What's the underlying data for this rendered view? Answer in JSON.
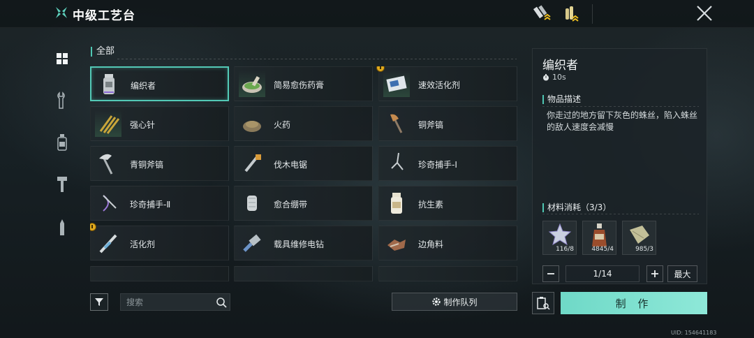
{
  "header": {
    "title": "中级工艺台",
    "icons": [
      "workbench-logo-icon",
      "tool-upgrade-icon",
      "ammo-upgrade-icon",
      "close-icon"
    ]
  },
  "sidenav": {
    "items": [
      {
        "icon": "grid-icon",
        "active": true
      },
      {
        "icon": "wrench-icon",
        "active": false
      },
      {
        "icon": "bottle-icon",
        "active": false
      },
      {
        "icon": "hammer-icon",
        "active": false
      },
      {
        "icon": "bullet-icon",
        "active": false
      }
    ]
  },
  "section": {
    "title": "全部"
  },
  "items": [
    {
      "label": "编织者",
      "icon": "weaver-jar-icon",
      "selected": true,
      "badge": false
    },
    {
      "label": "简易愈伤药膏",
      "icon": "mortar-ointment-icon",
      "selected": false,
      "badge": false
    },
    {
      "label": "速效活化剂",
      "icon": "activator-box-icon",
      "selected": false,
      "badge": true
    },
    {
      "label": "强心针",
      "icon": "syringes-icon",
      "selected": false,
      "badge": false
    },
    {
      "label": "火药",
      "icon": "gunpowder-icon",
      "selected": false,
      "badge": false
    },
    {
      "label": "铜斧镐",
      "icon": "copper-axe-icon",
      "selected": false,
      "badge": false
    },
    {
      "label": "青铜斧镐",
      "icon": "bronze-pickaxe-icon",
      "selected": false,
      "badge": false
    },
    {
      "label": "伐木电锯",
      "icon": "chainsaw-icon",
      "selected": false,
      "badge": false
    },
    {
      "label": "珍奇捕手-I",
      "icon": "grabber-icon",
      "selected": false,
      "badge": false
    },
    {
      "label": "珍奇捕手-Ⅱ",
      "icon": "grabber-bow-icon",
      "selected": false,
      "badge": false
    },
    {
      "label": "愈合绷带",
      "icon": "bandage-icon",
      "selected": false,
      "badge": false
    },
    {
      "label": "抗生素",
      "icon": "pill-bottle-icon",
      "selected": false,
      "badge": false
    },
    {
      "label": "活化剂",
      "icon": "injector-icon",
      "selected": false,
      "badge": true
    },
    {
      "label": "载具维修电钻",
      "icon": "drill-icon",
      "selected": false,
      "badge": false
    },
    {
      "label": "边角料",
      "icon": "scrap-icon",
      "selected": false,
      "badge": false
    }
  ],
  "footer": {
    "search_placeholder": "搜索",
    "queue_label": "制作队列"
  },
  "detail": {
    "title": "编织者",
    "time": "10s",
    "desc_heading": "物品描述",
    "description": "你走过的地方留下灰色的蛛丝，陷入蛛丝的敌人速度会减慢",
    "materials_heading": "材料消耗（3/3）",
    "materials": [
      {
        "icon": "star-crystal-icon",
        "count": "116/8"
      },
      {
        "icon": "fuel-bottle-icon",
        "count": "4845/4"
      },
      {
        "icon": "cloth-icon",
        "count": "985/3"
      }
    ],
    "quantity": "1/14",
    "max_label": "最大",
    "craft_label": "制 作"
  },
  "uid": "UID: 154641183",
  "colors": {
    "accent": "#53c9b6",
    "craft": "#7ee2d1",
    "badge": "#e0a91c"
  }
}
